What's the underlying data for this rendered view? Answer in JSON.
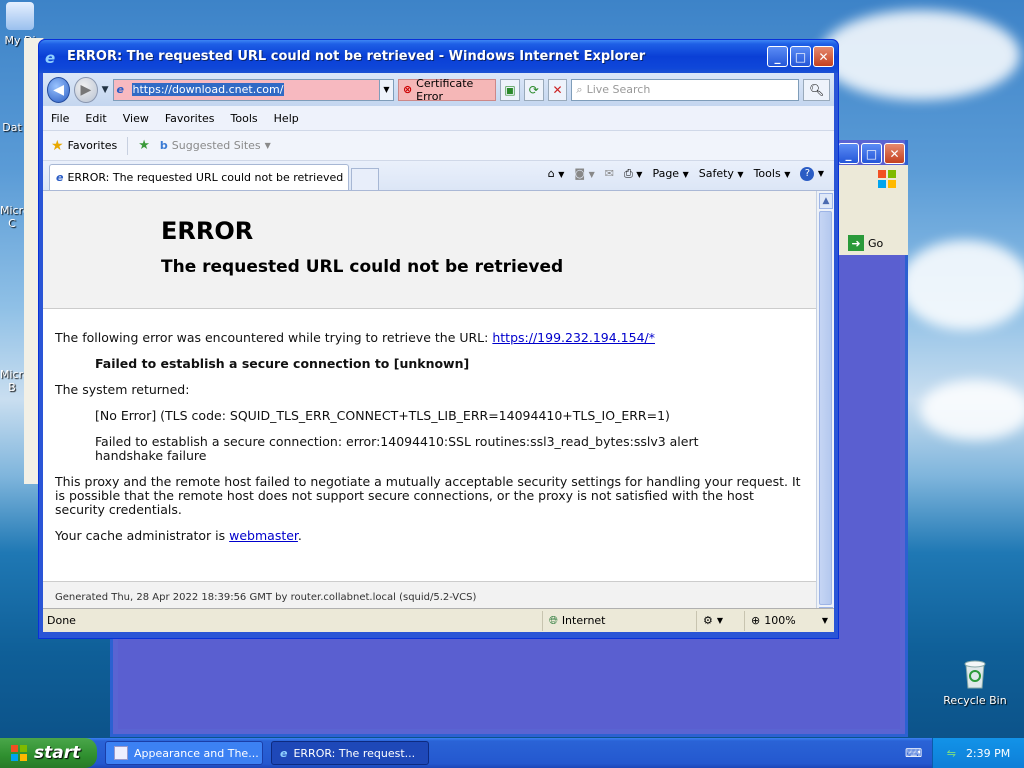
{
  "desktop": {
    "icons": [
      "My Di",
      "Dat",
      "Micro C",
      "Micro B"
    ],
    "recycle_bin": "Recycle Bin"
  },
  "bg_window": {
    "go_label": "Go"
  },
  "ie": {
    "title": "ERROR: The requested URL could not be retrieved - Windows Internet Explorer",
    "address": "https://download.cnet.com/",
    "cert_error": "Certificate Error",
    "search_placeholder": "Live Search",
    "menu": [
      "File",
      "Edit",
      "View",
      "Favorites",
      "Tools",
      "Help"
    ],
    "favorites_label": "Favorites",
    "suggested_sites": "Suggested Sites",
    "tab_title": "ERROR: The requested URL could not be retrieved",
    "cmd": {
      "page": "Page",
      "safety": "Safety",
      "tools": "Tools"
    },
    "status": {
      "text": "Done",
      "zone": "Internet",
      "zoom": "100%"
    }
  },
  "page": {
    "h1": "ERROR",
    "h2": "The requested URL could not be retrieved",
    "intro": "The following error was encountered while trying to retrieve the URL:",
    "link_url": "https://199.232.194.154/*",
    "fail_bold": "Failed to establish a secure connection to [unknown]",
    "system_returned": "The system returned:",
    "no_error": "[No Error] (TLS code: SQUID_TLS_ERR_CONNECT+TLS_LIB_ERR=14094410+TLS_IO_ERR=1)",
    "ssl_error": "Failed to establish a secure connection: error:14094410:SSL routines:ssl3_read_bytes:sslv3 alert handshake failure",
    "proxy_text": "This proxy and the remote host failed to negotiate a mutually acceptable security settings for handling your request. It is possible that the remote host does not support secure connections, or the proxy is not satisfied with the host security credentials.",
    "admin_prefix": "Your cache administrator is",
    "admin_link": "webmaster",
    "admin_suffix": ".",
    "generated": "Generated Thu, 28 Apr 2022 18:39:56 GMT by router.collabnet.local (squid/5.2-VCS)"
  },
  "taskbar": {
    "start": "start",
    "items": [
      "Appearance and The...",
      "ERROR: The request..."
    ],
    "clock": "2:39 PM"
  }
}
